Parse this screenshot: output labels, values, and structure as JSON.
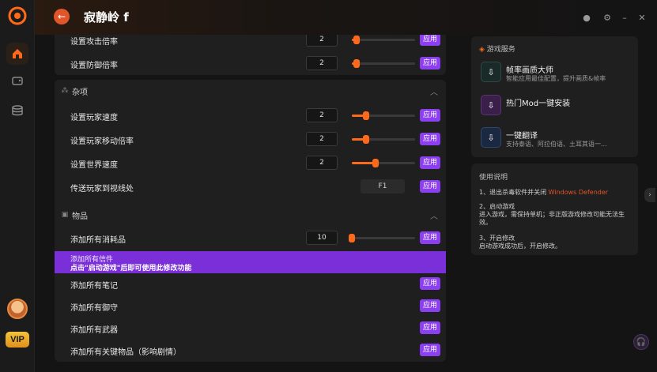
{
  "app": {
    "title": "寂静岭 f"
  },
  "sidebar": {
    "vip_label": "VIP"
  },
  "sections": {
    "top_rows": [
      {
        "label": "设置攻击倍率",
        "value": "2",
        "slider": 0.08,
        "apply": "应用"
      },
      {
        "label": "设置防御倍率",
        "value": "2",
        "slider": 0.08,
        "apply": "应用"
      }
    ],
    "misc": {
      "title": "杂项",
      "rows": [
        {
          "label": "设置玩家速度",
          "value": "2",
          "slider": 0.22,
          "apply": "应用"
        },
        {
          "label": "设置玩家移动倍率",
          "value": "2",
          "slider": 0.22,
          "apply": "应用"
        },
        {
          "label": "设置世界速度",
          "value": "2",
          "slider": 0.38,
          "apply": "应用"
        },
        {
          "label": "传送玩家到视线处",
          "key": "F1",
          "apply": "应用"
        }
      ]
    },
    "items": {
      "title": "物品",
      "rows": [
        {
          "label": "添加所有消耗品",
          "value": "10",
          "slider": 0.0,
          "apply": "应用"
        },
        {
          "label": "添加所有笔记",
          "apply": "应用"
        },
        {
          "label": "添加所有御守",
          "apply": "应用"
        },
        {
          "label": "添加所有武器",
          "apply": "应用"
        },
        {
          "label": "添加所有关键物品（影响剧情）",
          "apply": "应用"
        }
      ],
      "notice": {
        "line1": "添加所有信件",
        "line2": "点击\"启动游戏\"后即可使用此修改功能"
      }
    }
  },
  "services": {
    "title": "游戏服务",
    "items": [
      {
        "title": "帧率画质大师",
        "subtitle": "智能应用最佳配置，提升画质&帧率"
      },
      {
        "title": "热门Mod一键安装",
        "subtitle": ""
      },
      {
        "title": "一键翻译",
        "subtitle": "支持泰语、阿拉伯语、土耳其语一..."
      }
    ]
  },
  "guide": {
    "title": "使用说明",
    "step1_prefix": "1、退出杀毒软件并关闭 ",
    "step1_highlight": "Windows Defender",
    "step2_title": "2、启动游戏",
    "step2_body": "进入游戏，需保持单机；非正版游戏修改可能无法生效。",
    "step3_title": "3、开启修改",
    "step3_body": "启动游戏成功后，开启修改。"
  },
  "colors": {
    "accent": "#ff6a1a",
    "apply": "#8c3ff0",
    "back": "#e0552a"
  }
}
